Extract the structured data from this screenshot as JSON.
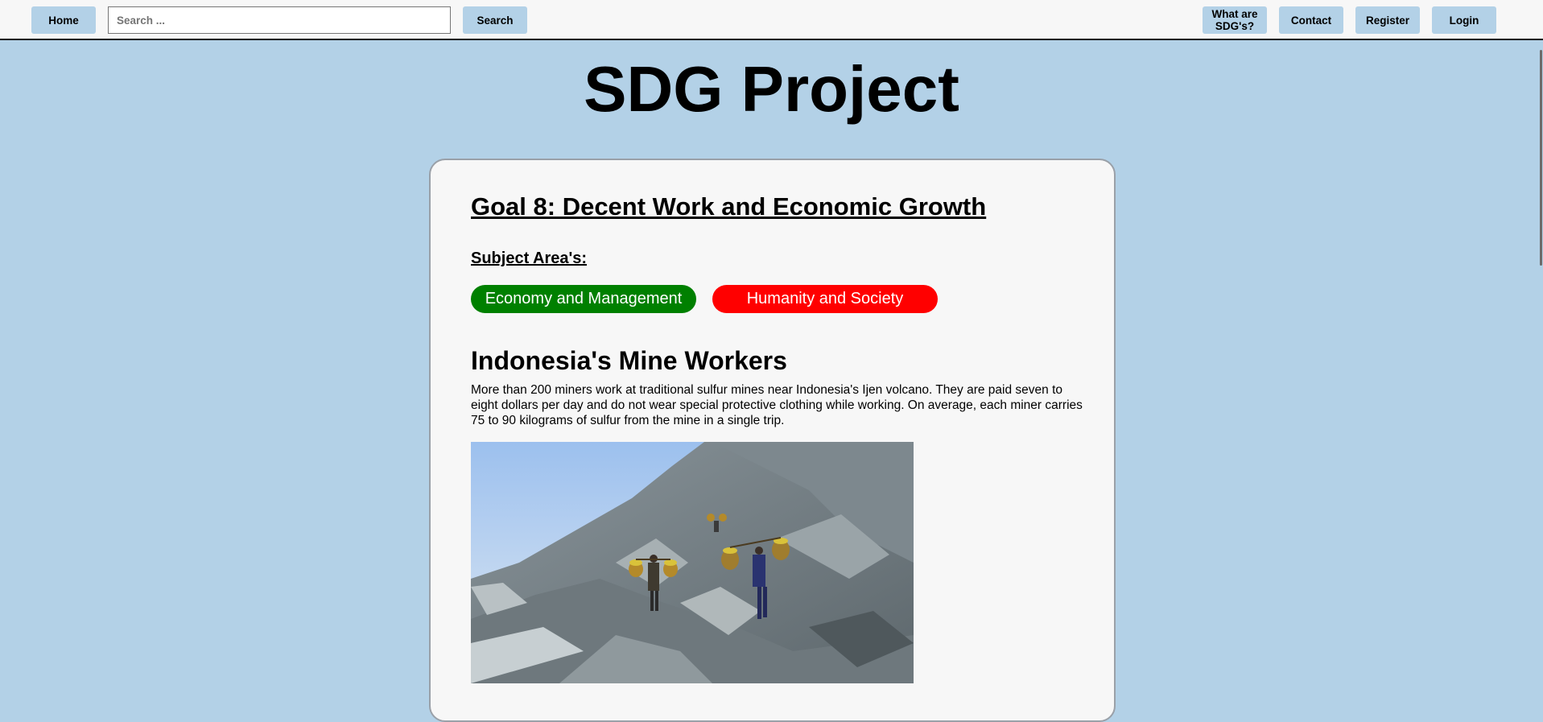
{
  "nav": {
    "home": "Home",
    "search_placeholder": "Search ...",
    "search_button": "Search",
    "what_are_line1": "What are",
    "what_are_line2": "SDG's?",
    "contact": "Contact",
    "register": "Register",
    "login": "Login"
  },
  "site_title": "SDG Project",
  "goal": {
    "title": "Goal 8: Decent Work and Economic Growth",
    "subject_area_label": "Subject Area's:",
    "subject_areas": [
      {
        "label": "Economy and Management",
        "color": "#008000"
      },
      {
        "label": "Humanity and Society",
        "color": "#ff0000"
      }
    ]
  },
  "article": {
    "title": "Indonesia's Mine Workers",
    "body": "More than 200 miners work at traditional sulfur mines near Indonesia's Ijen volcano. They are paid seven to eight dollars per day and do not wear special protective clothing while working. On average, each miner carries 75 to 90 kilograms of sulfur from the mine in a single trip."
  },
  "colors": {
    "page_background": "#b3d1e7",
    "card_background": "#f7f7f7",
    "button_background": "#b3d1e7"
  }
}
